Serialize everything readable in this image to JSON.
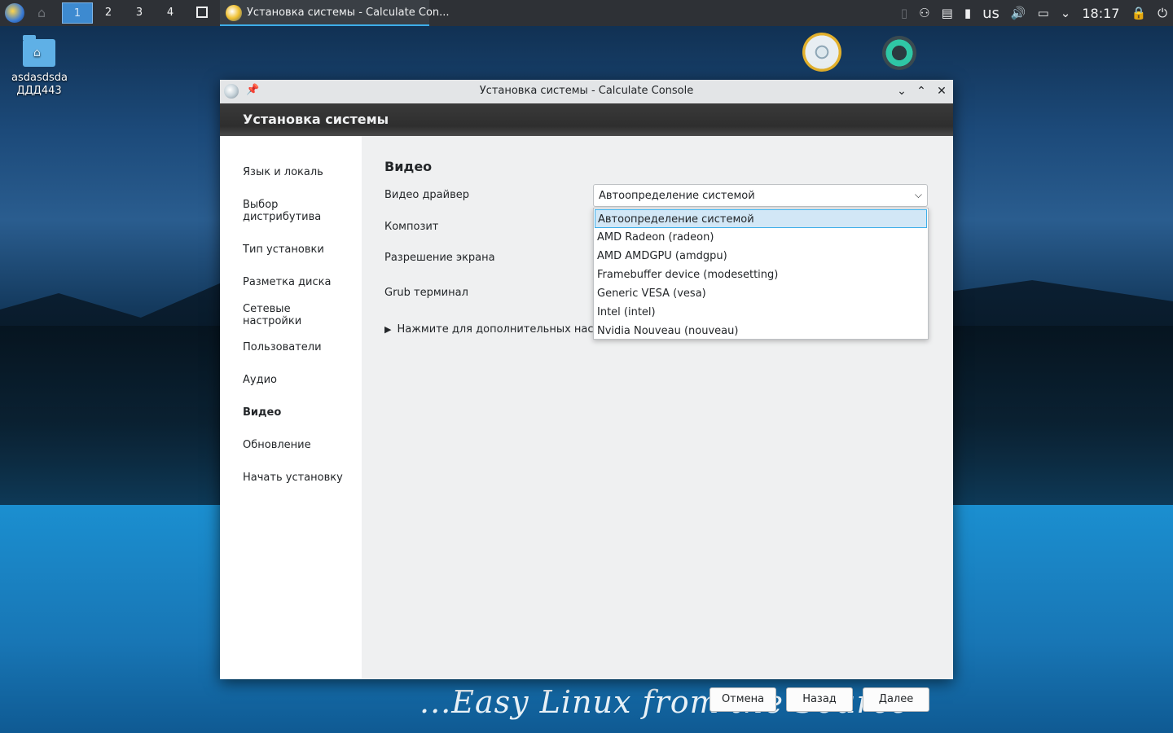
{
  "desktop": {
    "folder_label": "asdasdsda ДДД443",
    "slogan": "...Easy Linux from the Source"
  },
  "panel": {
    "pager": [
      "1",
      "2",
      "3",
      "4"
    ],
    "task_label": "Установка системы - Calculate Con...",
    "lang": "us",
    "clock": "18:17"
  },
  "window": {
    "title": "Установка системы - Calculate Console",
    "header": "Установка системы"
  },
  "sidebar": {
    "items": [
      {
        "label": "Язык и локаль"
      },
      {
        "label": "Выбор дистрибутива"
      },
      {
        "label": "Тип установки"
      },
      {
        "label": "Разметка диска"
      },
      {
        "label": "Сетевые настройки"
      },
      {
        "label": "Пользователи"
      },
      {
        "label": "Аудио"
      },
      {
        "label": "Видео"
      },
      {
        "label": "Обновление"
      },
      {
        "label": "Начать установку"
      }
    ]
  },
  "content": {
    "section_title": "Видео",
    "labels": {
      "driver": "Видео драйвер",
      "composite": "Композит",
      "resolution": "Разрешение экрана",
      "grub": "Grub терминал"
    },
    "driver_value": "Автоопределение системой",
    "expander": "Нажмите для дополнительных настро",
    "options": [
      "Автоопределение системой",
      "AMD Radeon (radeon)",
      "AMD AMDGPU (amdgpu)",
      "Framebuffer device (modesetting)",
      "Generic VESA (vesa)",
      "Intel (intel)",
      "Nvidia Nouveau (nouveau)"
    ]
  },
  "buttons": {
    "cancel": "Отмена",
    "back": "Назад",
    "next": "Далее"
  },
  "colors": {
    "accent": "#3daee9",
    "panel": "#2e3136",
    "selection": "#d2e7f6"
  }
}
